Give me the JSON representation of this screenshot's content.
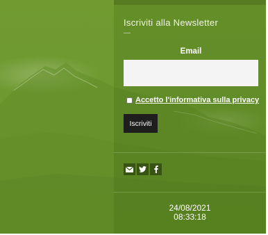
{
  "newsletter": {
    "title": "Iscriviti alla Newsletter",
    "email_label": "Email",
    "email_value": "",
    "privacy_label": "Accetto l'informativa sulla privacy",
    "privacy_checked": false,
    "subscribe_label": "Iscriviti"
  },
  "social": [
    {
      "icon": "mail-icon"
    },
    {
      "icon": "twitter-icon"
    },
    {
      "icon": "facebook-icon"
    }
  ],
  "footer": {
    "date": "24/08/2021",
    "time": "08:33:18"
  },
  "colors": {
    "background_green": "#6a962e",
    "button_bg": "#1e1e1e",
    "input_bg": "#f4f4f4"
  }
}
